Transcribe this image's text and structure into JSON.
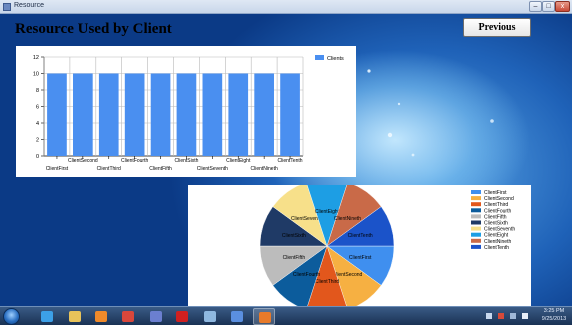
{
  "window": {
    "title": "Resource",
    "minimize": "–",
    "maximize": "□",
    "close": "x"
  },
  "header": {
    "title": "Resource Used by Client",
    "previous_label": "Previous"
  },
  "chart_data": [
    {
      "type": "bar",
      "categories": [
        "ClientFirst",
        "ClientSecond",
        "ClientThird",
        "ClientFourth",
        "ClientFifth",
        "ClientSixth",
        "ClientSeventh",
        "ClientEight",
        "ClientNineth",
        "ClientTenth"
      ],
      "series": [
        {
          "name": "Clients",
          "values": [
            10,
            10,
            10,
            10,
            10,
            10,
            10,
            10,
            10,
            10
          ]
        }
      ],
      "ylim": [
        0,
        12
      ],
      "yticks": [
        0,
        2,
        4,
        6,
        8,
        10,
        12
      ],
      "grid": true,
      "legend": "top-right",
      "color": "#4a8ff0"
    },
    {
      "type": "pie",
      "categories": [
        "ClientFirst",
        "ClientSecond",
        "ClientThird",
        "ClientFourth",
        "ClientFifth",
        "ClientSixth",
        "ClientSeventh",
        "ClientEight",
        "ClientNineth",
        "ClientTenth"
      ],
      "values": [
        1,
        1,
        1,
        1,
        1,
        1,
        1,
        1,
        1,
        1
      ],
      "colors": [
        "#3f8fef",
        "#f6b042",
        "#e2571c",
        "#0c5c9c",
        "#bcbcbc",
        "#1f3a66",
        "#f7e08a",
        "#1d9ee4",
        "#c96a48",
        "#1b53c9"
      ],
      "legend": "right"
    }
  ],
  "taskbar": {
    "apps": [
      {
        "icon": "internet-explorer-icon",
        "color": "#3ca0e8"
      },
      {
        "icon": "folder-icon",
        "color": "#e8c35a"
      },
      {
        "icon": "media-player-icon",
        "color": "#f08a2a"
      },
      {
        "icon": "chrome-icon",
        "color": "#d9473b"
      },
      {
        "icon": "visual-studio-icon",
        "color": "#6b7fd0"
      },
      {
        "icon": "acrobat-icon",
        "color": "#d02020"
      },
      {
        "icon": "screenshot-tool-icon",
        "color": "#8fb8e0"
      },
      {
        "icon": "app-icon-infinity",
        "color": "#5a8fe0"
      },
      {
        "icon": "resource-app-icon",
        "color": "#e77a2a"
      }
    ],
    "clock_time": "3:25 PM",
    "clock_date": "9/25/2013"
  }
}
